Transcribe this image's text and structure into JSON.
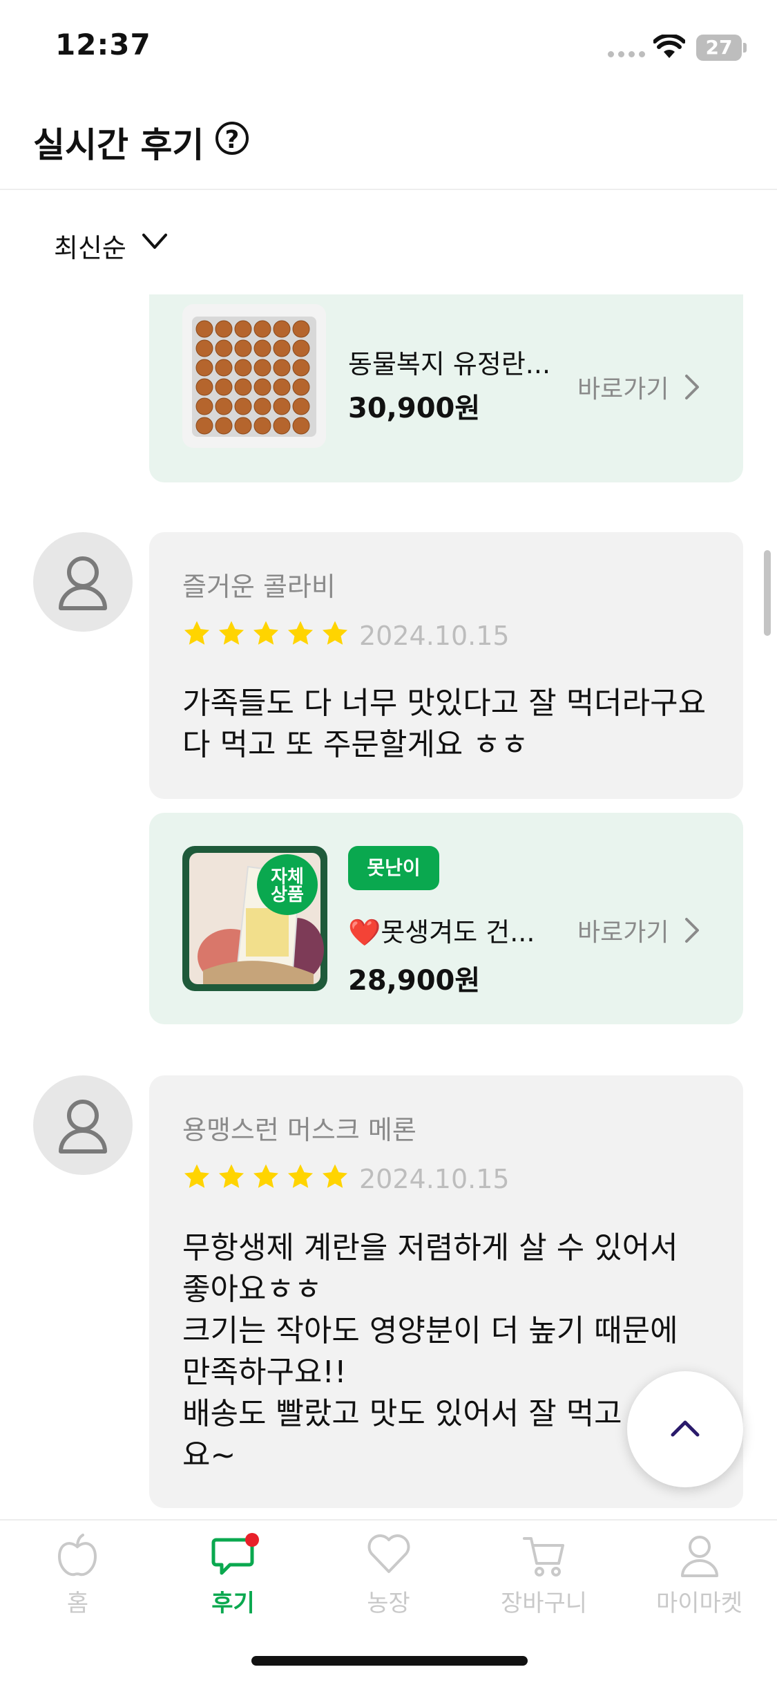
{
  "status_bar": {
    "time": "12:37",
    "battery": "27"
  },
  "header": {
    "title": "실시간 후기",
    "help_icon": "question-circle-icon"
  },
  "sort": {
    "label": "최신순"
  },
  "feed": {
    "product_top": {
      "name": "동물복지 유정란...",
      "price": "30,900원",
      "goto": "바로가기"
    },
    "reviews": [
      {
        "nickname": "즐거운 콜라비",
        "rating": 5,
        "date": "2024.10.15",
        "text": "가족들도 다 너무 맛있다고 잘 먹더라구요\n다 먹고 또 주문할게요 ㅎㅎ",
        "product": {
          "badge": "못난이",
          "thumb_tag": "자체\n상품",
          "name": "❤️못생겨도 건...",
          "price": "28,900원",
          "goto": "바로가기"
        }
      },
      {
        "nickname": "용맹스런 머스크 메론",
        "rating": 5,
        "date": "2024.10.15",
        "text": "무항생제 계란을 저렴하게 살 수 있어서\n좋아요ㅎㅎ\n크기는 작아도 영양분이 더 높기 때문에\n만족하구요!!\n배송도 빨랐고 맛도 있어서 잘 먹고\n요~"
      }
    ]
  },
  "bottom_nav": [
    {
      "label": "홈",
      "icon": "apple-icon",
      "active": false
    },
    {
      "label": "후기",
      "icon": "chat-bubble-icon",
      "active": true
    },
    {
      "label": "농장",
      "icon": "heart-icon",
      "active": false
    },
    {
      "label": "장바구니",
      "icon": "cart-icon",
      "active": false
    },
    {
      "label": "마이마켓",
      "icon": "user-icon",
      "active": false
    }
  ],
  "colors": {
    "accent": "#0aa84f",
    "card_green": "#e9f4ee",
    "card_gray": "#f2f2f2",
    "star": "#ffd400",
    "notification_dot": "#e8202a"
  }
}
